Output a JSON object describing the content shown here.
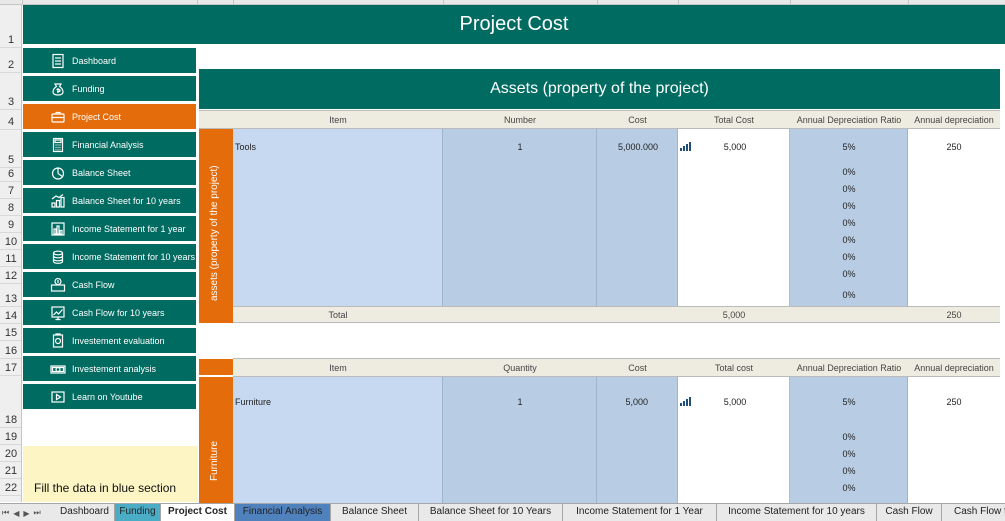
{
  "title": "Project Cost",
  "row_numbers": [
    "1",
    "2",
    "3",
    "4",
    "5",
    "6",
    "7",
    "8",
    "9",
    "10",
    "11",
    "12",
    "13",
    "14",
    "15",
    "16",
    "17",
    "18",
    "19",
    "20",
    "21",
    "22"
  ],
  "sidebar": {
    "items": [
      {
        "label": "Dashboard",
        "icon": "document-icon"
      },
      {
        "label": "Funding",
        "icon": "money-bag-icon"
      },
      {
        "label": "Project Cost",
        "icon": "briefcase-icon"
      },
      {
        "label": "Financial Analysis",
        "icon": "calculator-icon"
      },
      {
        "label": "Balance Sheet",
        "icon": "pie-chart-icon"
      },
      {
        "label": "Balance Sheet for 10 years",
        "icon": "bar-growth-icon"
      },
      {
        "label": "Income Statement for 1 year",
        "icon": "bar-chart-icon"
      },
      {
        "label": "Income Statement for 10 years",
        "icon": "coins-icon"
      },
      {
        "label": "Cash Flow",
        "icon": "cash-register-icon"
      },
      {
        "label": "Cash Flow for 10 years",
        "icon": "line-chart-icon"
      },
      {
        "label": "Investement evaluation",
        "icon": "money-stack-icon"
      },
      {
        "label": "Investement analysis",
        "icon": "banknote-icon"
      },
      {
        "label": "Learn on Youtube",
        "icon": "play-icon"
      }
    ],
    "active_index": 2,
    "hint": "Fill the data in blue section"
  },
  "assets": {
    "section_title": "Assets (property of the project)",
    "side_label": "assets (property of the project)",
    "headers": [
      "Item",
      "Number",
      "Cost",
      "Total Cost",
      "Annual Depreciation Ratio",
      "Annual depreciation"
    ],
    "row": {
      "item": "Tools",
      "number": "1",
      "cost": "5,000.000",
      "total": "5,000",
      "ratio": "5%",
      "depreciation": "250"
    },
    "empty_ratios": [
      "0%",
      "0%",
      "0%",
      "0%",
      "0%",
      "0%",
      "0%",
      "0%"
    ],
    "total_label": "Total",
    "total_cost": "5,000",
    "total_depreciation": "250"
  },
  "furniture": {
    "side_label": "Furniture",
    "headers": [
      "Item",
      "Quantity",
      "Cost",
      "Total cost",
      "Annual Depreciation Ratio",
      "Annual depreciation"
    ],
    "row": {
      "item": "Furniture",
      "number": "1",
      "cost": "5,000",
      "total": "5,000",
      "ratio": "5%",
      "depreciation": "250"
    },
    "empty_ratios": [
      "0%",
      "0%",
      "0%",
      "0%"
    ]
  },
  "sheet_tabs": [
    "Dashboard",
    "Funding",
    "Project Cost",
    "Financial Analysis",
    "Balance Sheet",
    "Balance Sheet for 10 Years",
    "Income Statement for 1 Year",
    "Income Statement for 10 years",
    "Cash Flow",
    "Cash Flow f"
  ],
  "active_tab": "Project Cost",
  "colors": {
    "teal": "#006b61",
    "orange": "#e46c0a",
    "input_blue": "#c6d9f1",
    "hint_yellow": "#fdf6c4"
  }
}
